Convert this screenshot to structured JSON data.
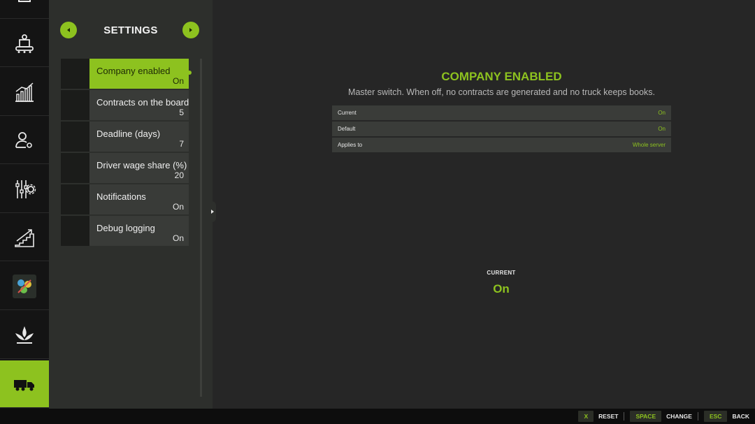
{
  "rail": {
    "items": [
      {
        "icon": "clipboard-icon",
        "active": false
      },
      {
        "icon": "factory-conveyor-icon",
        "active": false
      },
      {
        "icon": "bar-chart-icon",
        "active": false
      },
      {
        "icon": "user-settings-icon",
        "active": false
      },
      {
        "icon": "sliders-gear-icon",
        "active": false
      },
      {
        "icon": "stairs-chart-icon",
        "active": false
      },
      {
        "icon": "map-thumbnail-icon",
        "active": false
      },
      {
        "icon": "plant-sprout-icon",
        "active": false
      },
      {
        "icon": "truck-icon",
        "active": true
      }
    ]
  },
  "panel": {
    "title": "SETTINGS",
    "items": [
      {
        "label": "Company enabled",
        "value": "On"
      },
      {
        "label": "Contracts on the board",
        "value": "5"
      },
      {
        "label": "Deadline (days)",
        "value": "7"
      },
      {
        "label": "Driver wage share (%)",
        "value": "20"
      },
      {
        "label": "Notifications",
        "value": "On"
      },
      {
        "label": "Debug logging",
        "value": "On"
      }
    ]
  },
  "detail": {
    "title": "COMPANY ENABLED",
    "description": "Master switch. When off, no contracts are generated and no truck keeps books.",
    "rows": [
      {
        "key": "Current",
        "value": "On"
      },
      {
        "key": "Default",
        "value": "On"
      },
      {
        "key": "Applies to",
        "value": "Whole server"
      }
    ],
    "current_label": "CURRENT",
    "current_value": "On"
  },
  "hints": [
    {
      "key": "X",
      "label": "RESET"
    },
    {
      "key": "SPACE",
      "label": "CHANGE"
    },
    {
      "key": "ESC",
      "label": "BACK"
    }
  ],
  "colors": {
    "accent": "#8dc21f",
    "background": "#262626",
    "rail": "#141414",
    "panel": "#2d2f2c"
  }
}
